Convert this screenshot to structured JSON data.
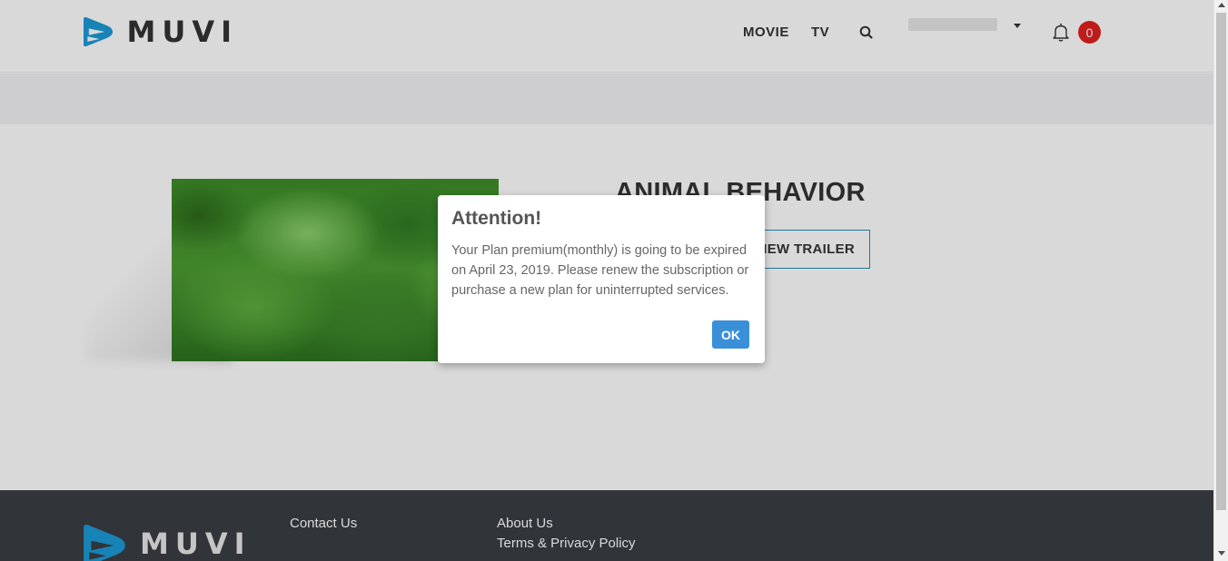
{
  "brand": {
    "name": "MUVI",
    "accent_color": "#1d9ad6"
  },
  "header": {
    "nav": [
      {
        "label": "MOVIE"
      },
      {
        "label": "TV"
      }
    ],
    "search_icon": "search-icon",
    "user_menu_icon": "caret-down-icon",
    "notifications": {
      "icon": "bell-icon",
      "count": "0",
      "badge_color": "#e02020"
    }
  },
  "content": {
    "title": "ANIMAL BEHAVIOR",
    "trailer_label": "VIEW TRAILER"
  },
  "modal": {
    "title": "Attention!",
    "message": "Your Plan premium(monthly) is going to be expired on April 23, 2019. Please renew the subscription or purchase a new plan for uninterrupted services.",
    "ok_label": "OK",
    "button_color": "#3a8fd9"
  },
  "footer": {
    "links": [
      {
        "label": "Contact Us"
      },
      {
        "label": "About Us"
      },
      {
        "label": "Terms & Privacy Policy"
      }
    ]
  }
}
